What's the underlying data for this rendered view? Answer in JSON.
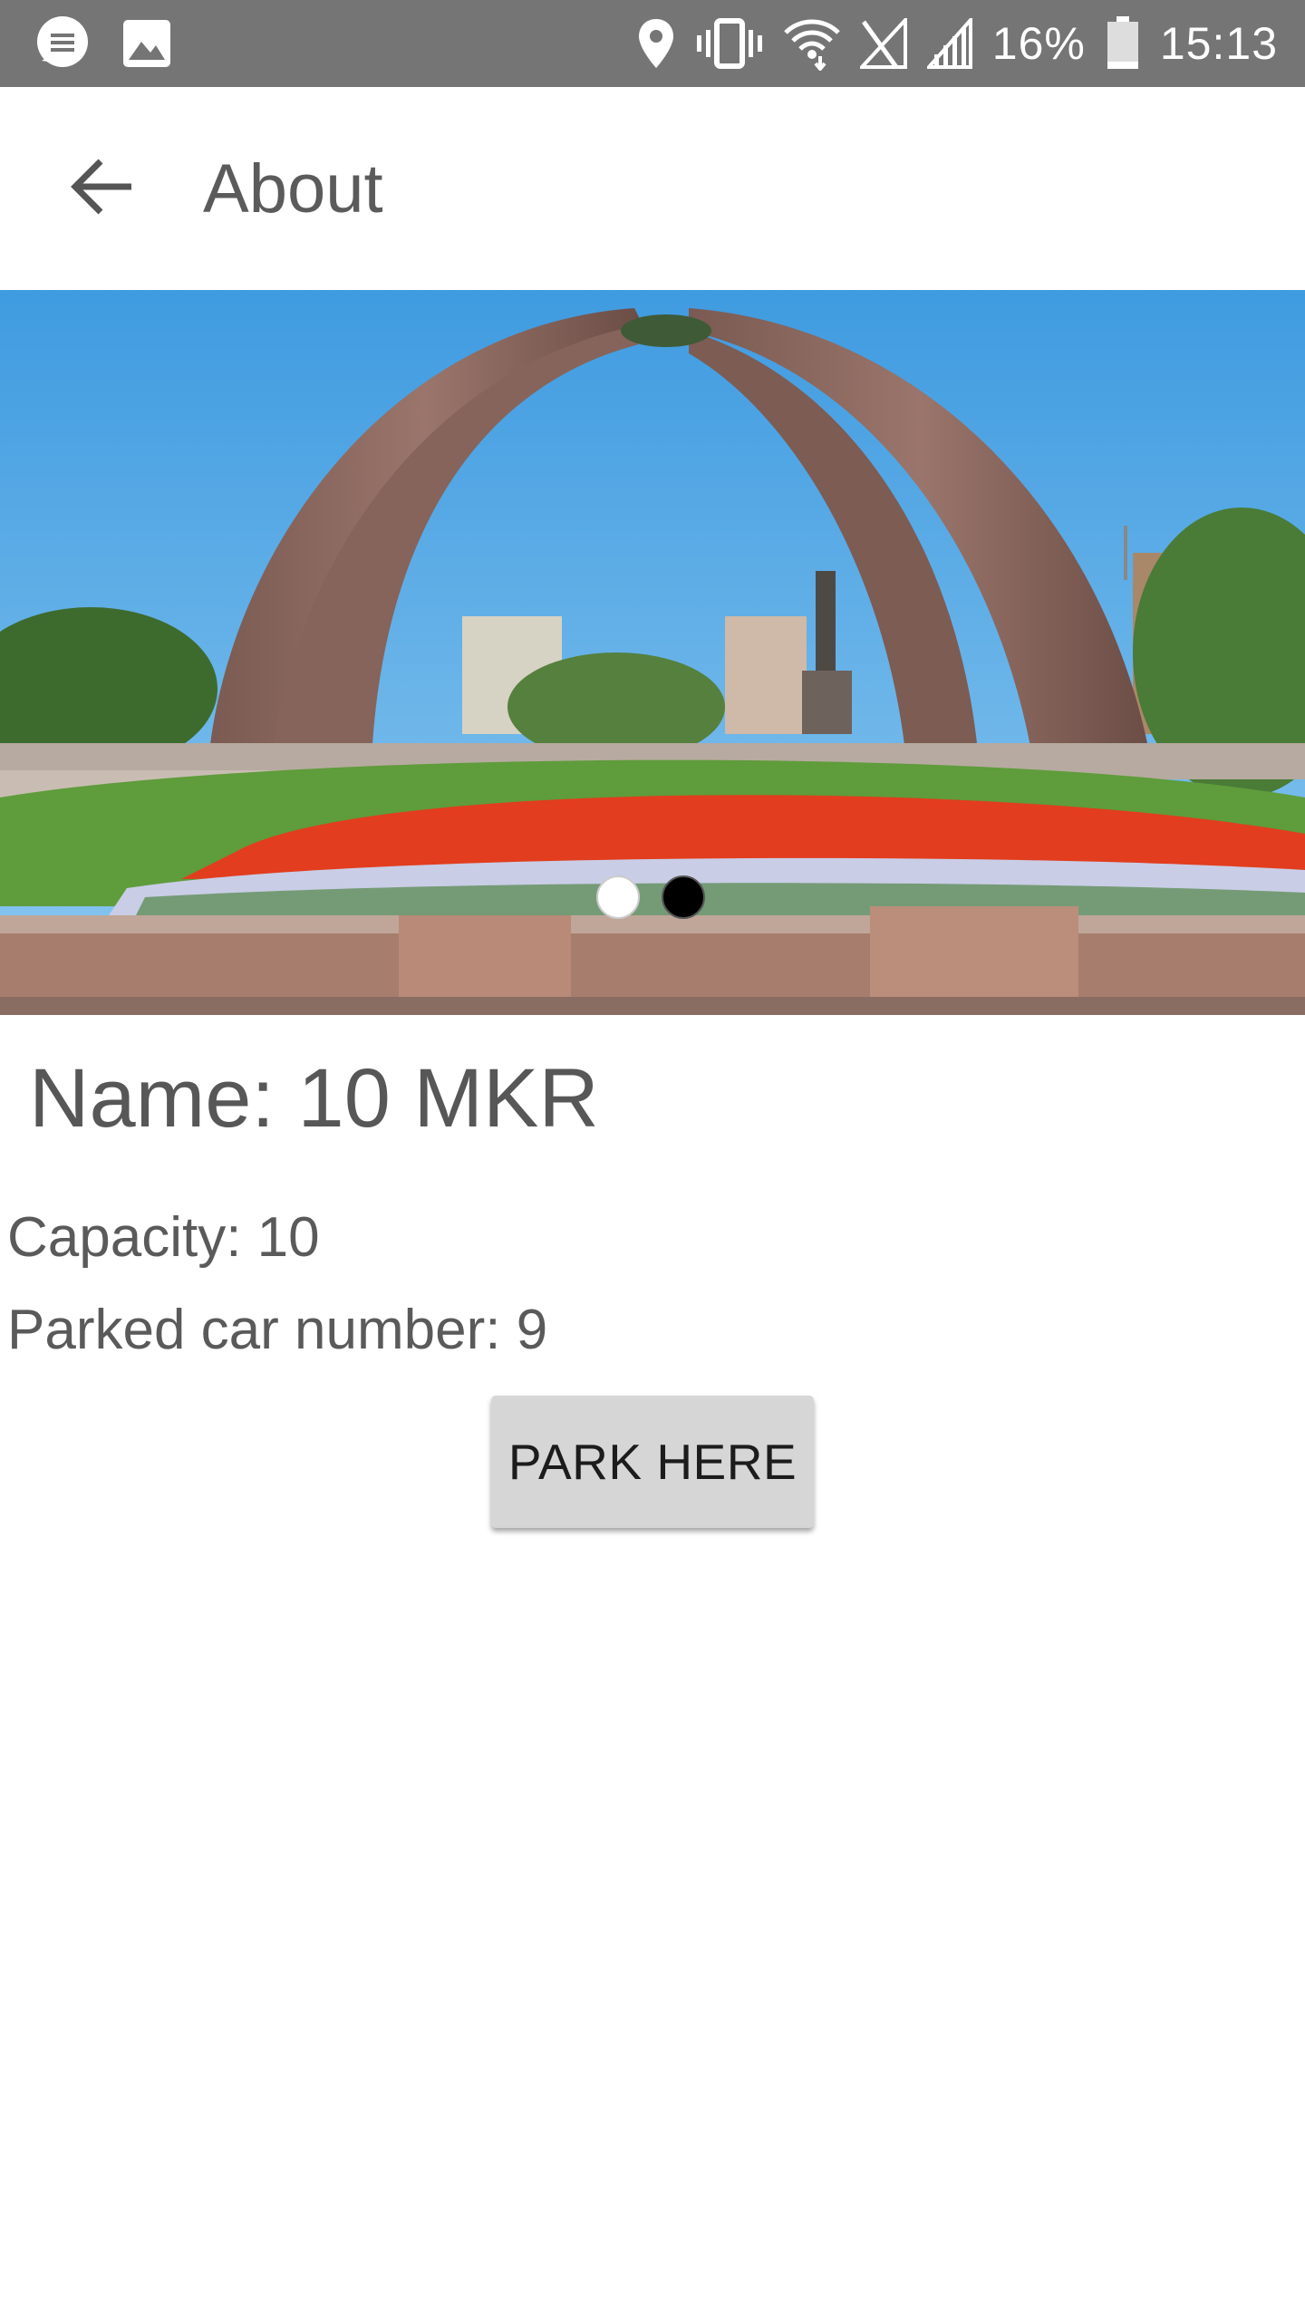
{
  "status_bar": {
    "battery": "16%",
    "time": "15:13",
    "icons": [
      "chat-icon",
      "image-icon",
      "location-icon",
      "vibrate-icon",
      "wifi-icon",
      "signal-off-icon",
      "signal-icon",
      "battery-icon"
    ]
  },
  "app_bar": {
    "title": "About",
    "back_icon": "arrow-back-icon"
  },
  "carousel": {
    "page_count": 2,
    "active_index": 0
  },
  "details": {
    "name": "Name: 10 MKR",
    "capacity": "Capacity: 10",
    "parked": "Parked car number: 9"
  },
  "actions": {
    "park_label": "PARK HERE"
  },
  "colors": {
    "status_bar": "#757575",
    "button": "#d6d6d6",
    "text": "#555555"
  }
}
